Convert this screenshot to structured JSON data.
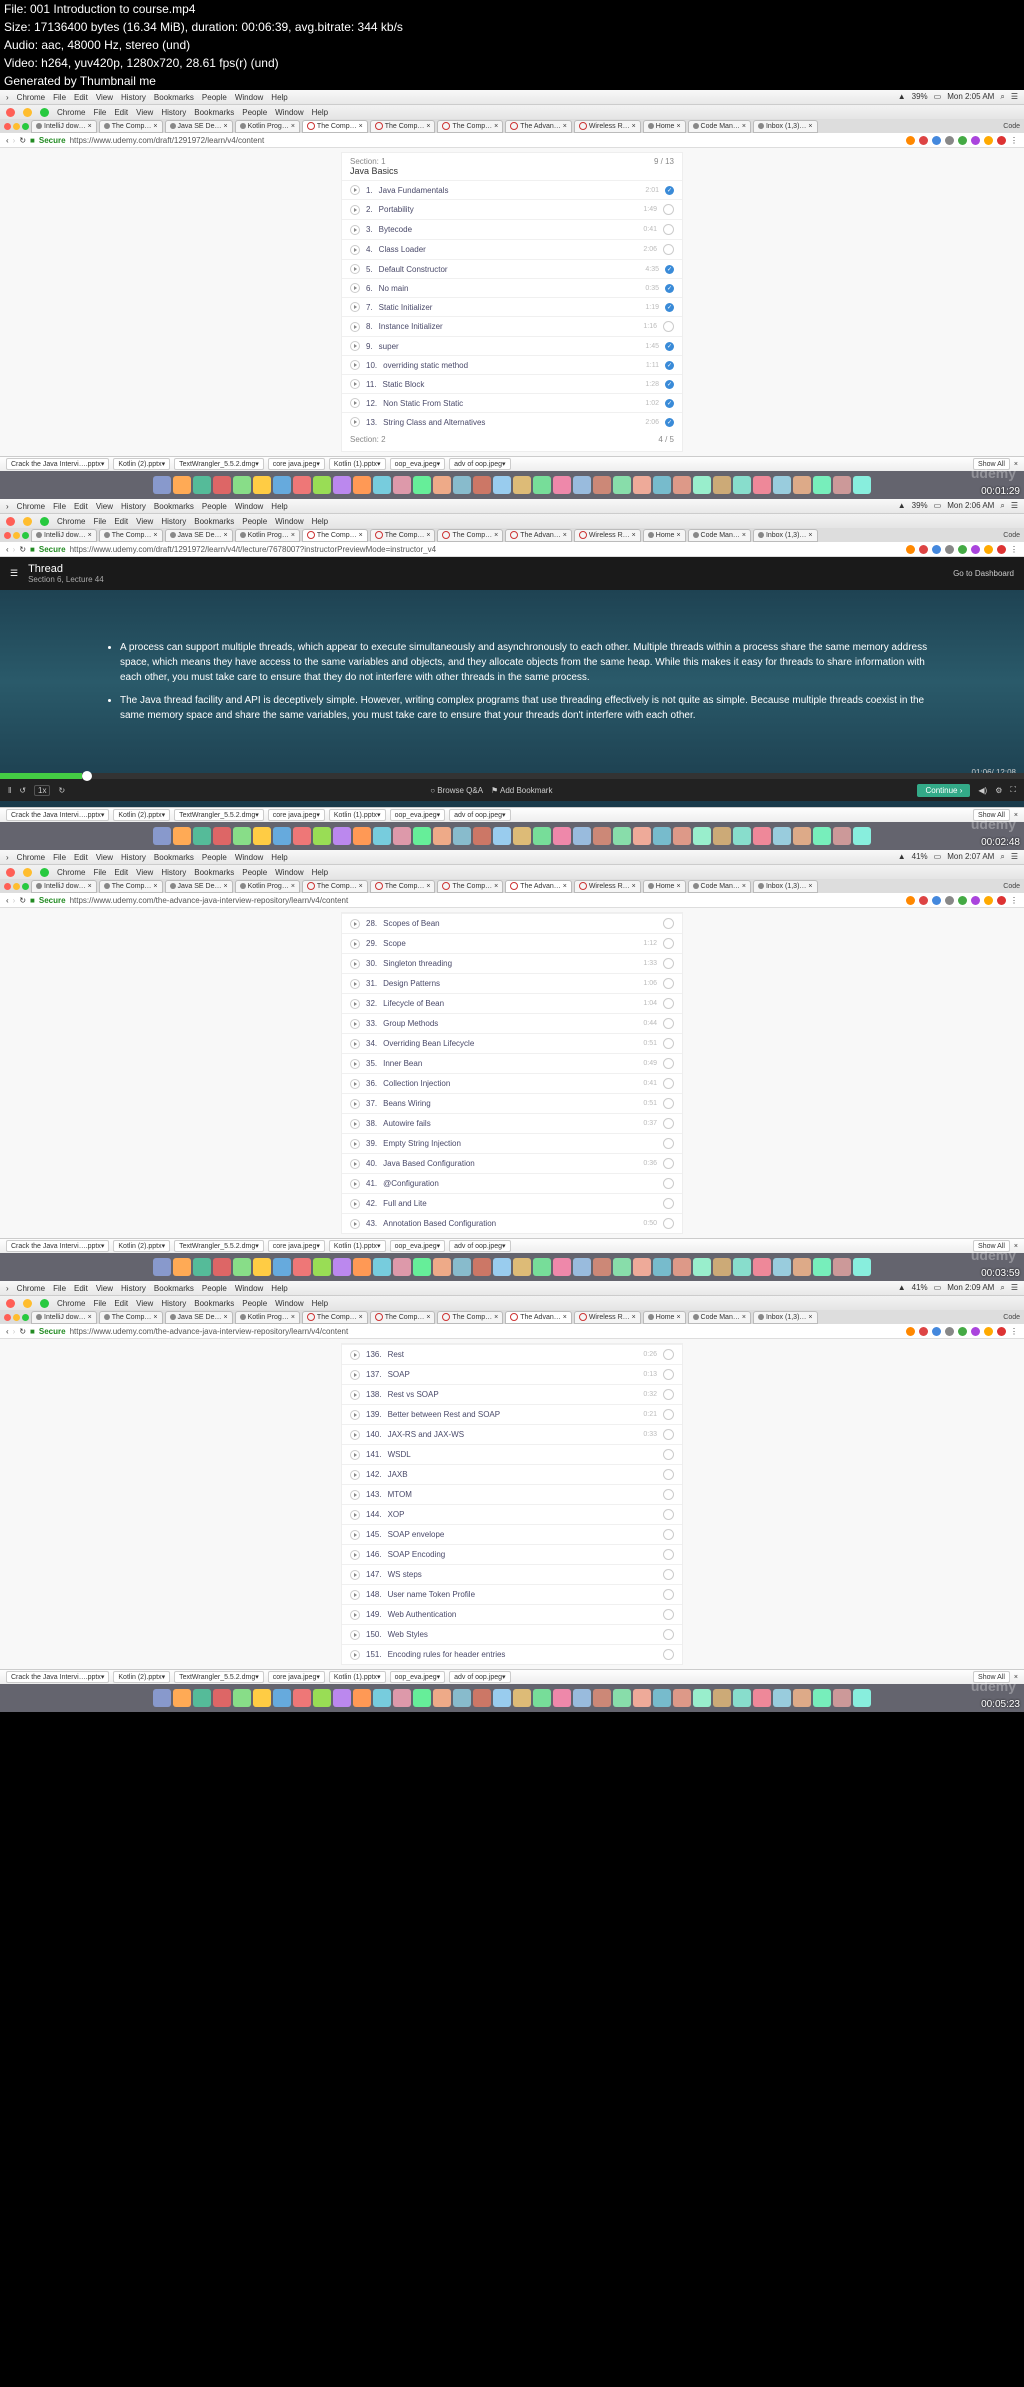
{
  "meta": {
    "file": "File: 001 Introduction to course.mp4",
    "size": "Size: 17136400 bytes (16.34 MiB), duration: 00:06:39, avg.bitrate: 344 kb/s",
    "audio": "Audio: aac, 48000 Hz, stereo (und)",
    "video": "Video: h264, yuv420p, 1280x720, 28.61 fps(r) (und)",
    "gen": "Generated by Thumbnail me"
  },
  "macMenu": [
    "Chrome",
    "File",
    "Edit",
    "View",
    "History",
    "Bookmarks",
    "People",
    "Window",
    "Help"
  ],
  "tabs1": [
    "IntelliJ dow…",
    "The Comp…",
    "Java SE De…",
    "Kotlin Prog…",
    "The Comp…",
    "The Comp…",
    "The Comp…",
    "The Advan…",
    "Wireless R…",
    "Home",
    "Code Man…",
    "Inbox (1,3)…"
  ],
  "tabs3": [
    "IntelliJ dow…",
    "The Comp…",
    "Java SE De…",
    "Kotlin Prog…",
    "The Comp…",
    "The Comp…",
    "The Comp…",
    "The Advan…",
    "Wireless R…",
    "Home",
    "Code Man…",
    "Inbox (1,3)…"
  ],
  "url1": "https://www.udemy.com/draft/1291972/learn/v4/content",
  "url2": "https://www.udemy.com/draft/1291972/learn/v4/t/lecture/7678007?instructorPreviewMode=instructor_v4",
  "url3": "https://www.udemy.com/the-advance-java-interview-repository/learn/v4/content",
  "url4": "https://www.udemy.com/the-advance-java-interview-repository/learn/v4/content",
  "secure": "Secure",
  "list1": {
    "secLabel": "Section: 1",
    "title": "Java Basics",
    "count": "9 / 13",
    "items": [
      {
        "n": "1.",
        "t": "Java Fundamentals",
        "d": "2:01",
        "c": true
      },
      {
        "n": "2.",
        "t": "Portability",
        "d": "1:49",
        "c": false
      },
      {
        "n": "3.",
        "t": "Bytecode",
        "d": "0:41",
        "c": false
      },
      {
        "n": "4.",
        "t": "Class Loader",
        "d": "2:06",
        "c": false
      },
      {
        "n": "5.",
        "t": "Default Constructor",
        "d": "4:35",
        "c": true
      },
      {
        "n": "6.",
        "t": "No main",
        "d": "0:35",
        "c": true
      },
      {
        "n": "7.",
        "t": "Static Initializer",
        "d": "1:19",
        "c": true
      },
      {
        "n": "8.",
        "t": "Instance Initializer",
        "d": "1:16",
        "c": false
      },
      {
        "n": "9.",
        "t": "super",
        "d": "1:45",
        "c": true
      },
      {
        "n": "10.",
        "t": "overriding static method",
        "d": "1:11",
        "c": true
      },
      {
        "n": "11.",
        "t": "Static Block",
        "d": "1:28",
        "c": true
      },
      {
        "n": "12.",
        "t": "Non Static From Static",
        "d": "1:02",
        "c": true
      },
      {
        "n": "13.",
        "t": "String Class and Alternatives",
        "d": "2:06",
        "c": true
      }
    ],
    "sec2": "Section: 2",
    "sec2c": "4 / 5"
  },
  "video": {
    "title": "Thread",
    "sub": "Section 6, Lecture 44",
    "dash": "Go to Dashboard",
    "b1": "A process can support multiple threads, which appear to execute simultaneously and asynchronously to each other. Multiple threads within a process share the same memory address space, which means they have access to the same variables and objects, and they allocate objects from the same heap. While this makes it easy for threads to share information with each other, you must take care to ensure that they do not interfere with other threads in the same process.",
    "b2": "The Java thread facility and API is deceptively simple. However, writing complex programs that use threading effectively is not quite as simple. Because multiple threads coexist in the same memory space and share the same variables, you must take care to ensure that your threads don't interfere with each other.",
    "time": "01:06/ 12:08",
    "browse": "Browse Q&A",
    "bookmark": "Add Bookmark",
    "cont": "Continue",
    "speed": "1x"
  },
  "list3": {
    "items": [
      {
        "n": "28.",
        "t": "Scopes of Bean",
        "d": ""
      },
      {
        "n": "29.",
        "t": "Scope",
        "d": "1:12"
      },
      {
        "n": "30.",
        "t": "Singleton threading",
        "d": "1:33"
      },
      {
        "n": "31.",
        "t": "Design Patterns",
        "d": "1:06"
      },
      {
        "n": "32.",
        "t": "Lifecycle of Bean",
        "d": "1:04"
      },
      {
        "n": "33.",
        "t": "Group Methods",
        "d": "0:44"
      },
      {
        "n": "34.",
        "t": "Overriding Bean Lifecycle",
        "d": "0:51"
      },
      {
        "n": "35.",
        "t": "Inner Bean",
        "d": "0:49"
      },
      {
        "n": "36.",
        "t": "Collection Injection",
        "d": "0:41"
      },
      {
        "n": "37.",
        "t": "Beans Wiring",
        "d": "0:51"
      },
      {
        "n": "38.",
        "t": "Autowire fails",
        "d": "0:37"
      },
      {
        "n": "39.",
        "t": "Empty String Injection",
        "d": ""
      },
      {
        "n": "40.",
        "t": "Java Based Configuration",
        "d": "0:36"
      },
      {
        "n": "41.",
        "t": "@Configuration",
        "d": ""
      },
      {
        "n": "42.",
        "t": "Full and Lite",
        "d": ""
      },
      {
        "n": "43.",
        "t": "Annotation Based Configuration",
        "d": "0:50"
      }
    ]
  },
  "list4": {
    "items": [
      {
        "n": "136.",
        "t": "Rest",
        "d": "0:26"
      },
      {
        "n": "137.",
        "t": "SOAP",
        "d": "0:13"
      },
      {
        "n": "138.",
        "t": "Rest vs SOAP",
        "d": "0:32"
      },
      {
        "n": "139.",
        "t": "Better between Rest and SOAP",
        "d": "0:21"
      },
      {
        "n": "140.",
        "t": "JAX-RS and JAX-WS",
        "d": "0:33"
      },
      {
        "n": "141.",
        "t": "WSDL",
        "d": ""
      },
      {
        "n": "142.",
        "t": "JAXB",
        "d": ""
      },
      {
        "n": "143.",
        "t": "MTOM",
        "d": ""
      },
      {
        "n": "144.",
        "t": "XOP",
        "d": ""
      },
      {
        "n": "145.",
        "t": "SOAP envelope",
        "d": ""
      },
      {
        "n": "146.",
        "t": "SOAP Encoding",
        "d": ""
      },
      {
        "n": "147.",
        "t": "WS steps",
        "d": ""
      },
      {
        "n": "148.",
        "t": "User name Token Profile",
        "d": ""
      },
      {
        "n": "149.",
        "t": "Web Authentication",
        "d": ""
      },
      {
        "n": "150.",
        "t": "Web Styles",
        "d": ""
      },
      {
        "n": "151.",
        "t": "Encoding rules for header entries",
        "d": ""
      }
    ]
  },
  "footerTabs": [
    "Crack the Java Intervi….pptx",
    "Kotlin (2).pptx",
    "TextWrangler_5.5.2.dmg",
    "core java.jpeg",
    "Kotlin (1).pptx",
    "oop_eva.jpeg",
    "adv of oop.jpeg"
  ],
  "showAll": "Show All",
  "times": [
    "Mon 2:05 AM",
    "Mon 2:06 AM",
    "Mon 2:07 AM",
    "Mon 2:09 AM"
  ],
  "batt": [
    "39%",
    "39%",
    "41%",
    "41%"
  ],
  "stamps": [
    "00:01:29",
    "00:02:48",
    "00:03:59",
    "00:05:23"
  ],
  "wm": "udemy",
  "codeLbl": "Code",
  "dockCount": 36
}
